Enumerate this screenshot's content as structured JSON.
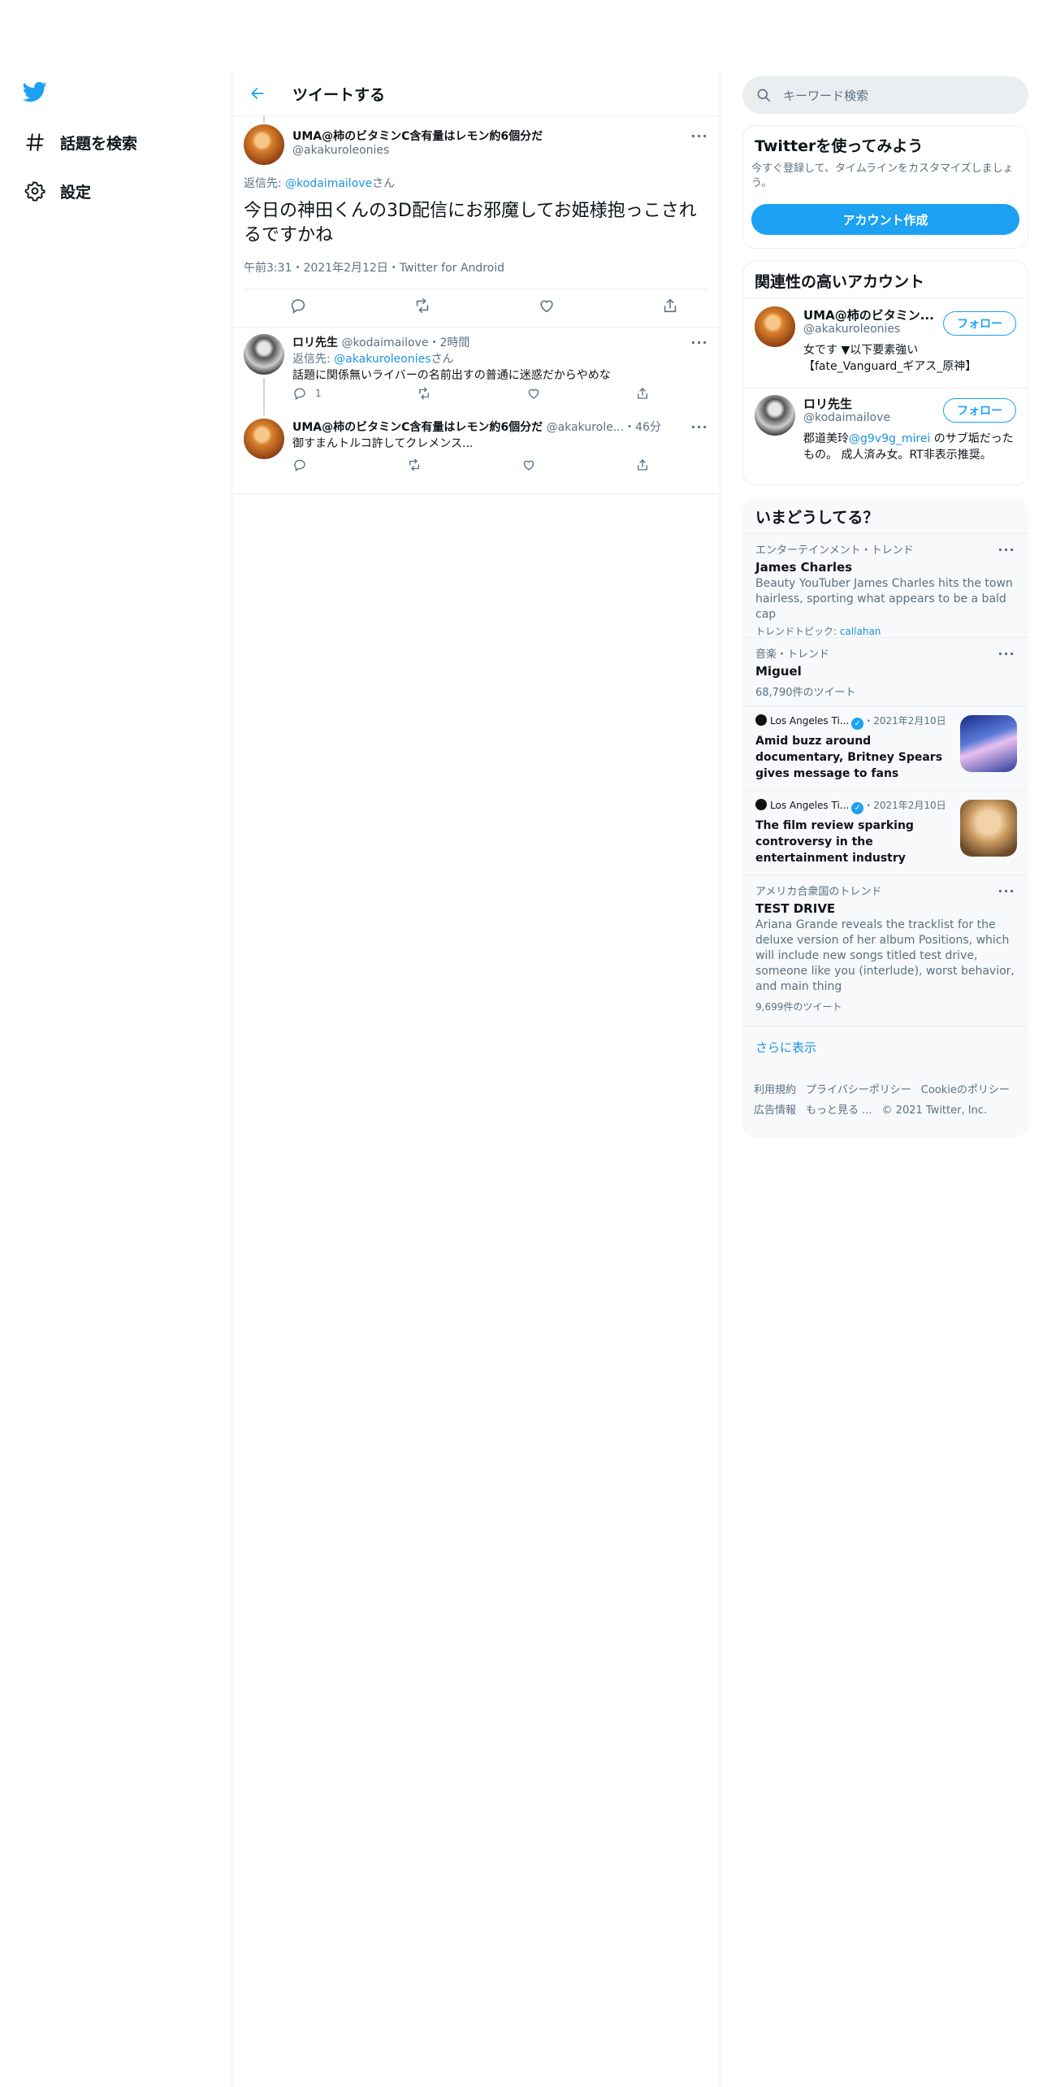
{
  "nav": {
    "items": [
      {
        "label": "話題を検索",
        "icon": "hashtag-icon"
      },
      {
        "label": "設定",
        "icon": "gear-icon"
      }
    ]
  },
  "main": {
    "header_title": "ツイートする",
    "tweet": {
      "author_name": "UMA@柿のビタミンC含有量はレモン約6個分だ",
      "author_handle": "@akakuroleonies",
      "reply_prefix": "返信先: ",
      "reply_handle": "@kodaimailove",
      "reply_suffix": "さん",
      "text": "今日の神田くんの3D配信にお邪魔してお姫様抱っこされるですかね",
      "meta": "午前3:31・2021年2月12日・Twitter for Android"
    },
    "replies": [
      {
        "author_name": "ロリ先生",
        "author_handle": "@kodaimailove",
        "time": "・2時間",
        "reply_prefix": "返信先: ",
        "reply_handle": "@akakuroleonies",
        "reply_suffix": "さん",
        "text": "話題に関係無いライバーの名前出すの普通に迷惑だからやめな",
        "reply_count": "1"
      },
      {
        "author_name": "UMA@柿のビタミンC含有量はレモン約6個分だ",
        "author_handle": "@akakurole...",
        "time": "・46分",
        "text": "御すまんトルコ許してクレメンス..."
      }
    ]
  },
  "right": {
    "search_placeholder": "キーワード検索",
    "signup": {
      "title": "Twitterを使ってみよう",
      "desc": "今すぐ登録して、タイムラインをカスタマイズしましょう。",
      "button": "アカウント作成"
    },
    "related": {
      "title": "関連性の高いアカウント",
      "accounts": [
        {
          "name": "UMA@柿のビタミン...",
          "handle": "@akakuroleonies",
          "follow": "フォロー",
          "bio": "女です ▼以下要素強い【fate_Vanguard_ギアス_原神】"
        },
        {
          "name": "ロリ先生",
          "handle": "@kodaimailove",
          "follow": "フォロー",
          "bio_pre": "郡道美玲",
          "bio_link": "@g9v9g_mirei",
          "bio_post": " のサブ垢だったもの。 成人済み女。RT非表示推奨。"
        }
      ]
    },
    "trends": {
      "title": "いまどうしてる？",
      "items": [
        {
          "context": "エンターテインメント・トレンド",
          "name": "James Charles",
          "desc": "Beauty YouTuber James Charles hits the town hairless, sporting what appears to be a bald cap",
          "topic_prefix": "トレンドトピック: ",
          "topic": "callahan"
        },
        {
          "context": "音楽・トレンド",
          "name": "Miguel",
          "count": "68,790件のツイート"
        },
        {
          "source": "Los Angeles Ti...",
          "date": "・2021年2月10日",
          "headline": "Amid buzz around documentary, Britney Spears gives message to fans"
        },
        {
          "source": "Los Angeles Ti...",
          "date": "・2021年2月10日",
          "headline": "The film review sparking controversy in the entertainment industry"
        },
        {
          "context": "アメリカ合衆国のトレンド",
          "name": "TEST DRIVE",
          "desc": "Ariana Grande reveals the tracklist for the deluxe version of her album Positions, which will include new songs titled test drive, someone like you (interlude), worst behavior, and main thing",
          "count": "9,699件のツイート"
        }
      ],
      "show_more": "さらに表示"
    },
    "footer": {
      "links": [
        "利用規約",
        "プライバシーポリシー",
        "Cookieのポリシー",
        "広告情報",
        "もっと見る ..."
      ],
      "copyright": "© 2021 Twitter, Inc."
    }
  }
}
